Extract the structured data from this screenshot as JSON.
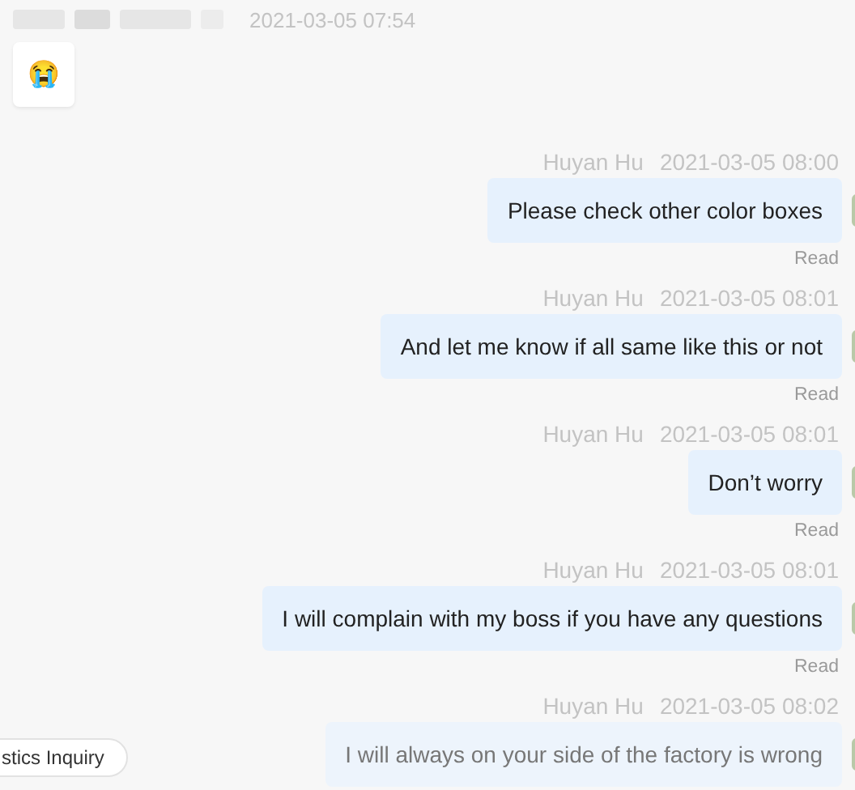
{
  "incoming": {
    "time": "2021-03-05 07:54",
    "emoji": "😭"
  },
  "messages": [
    {
      "sender": "Huyan Hu",
      "time": "2021-03-05 08:00",
      "text": "Please check other color boxes",
      "status": "Read"
    },
    {
      "sender": "Huyan Hu",
      "time": "2021-03-05 08:01",
      "text": "And let me know if all same like this or not",
      "status": "Read"
    },
    {
      "sender": "Huyan Hu",
      "time": "2021-03-05 08:01",
      "text": "Don’t worry",
      "status": "Read"
    },
    {
      "sender": "Huyan Hu",
      "time": "2021-03-05 08:01",
      "text": "I will complain with my boss if you have any questions",
      "status": "Read"
    },
    {
      "sender": "Huyan Hu",
      "time": "2021-03-05 08:02",
      "text": "I will always on your side of the factory is wrong"
    }
  ],
  "quick_chip": {
    "label": "stics Inquiry"
  }
}
